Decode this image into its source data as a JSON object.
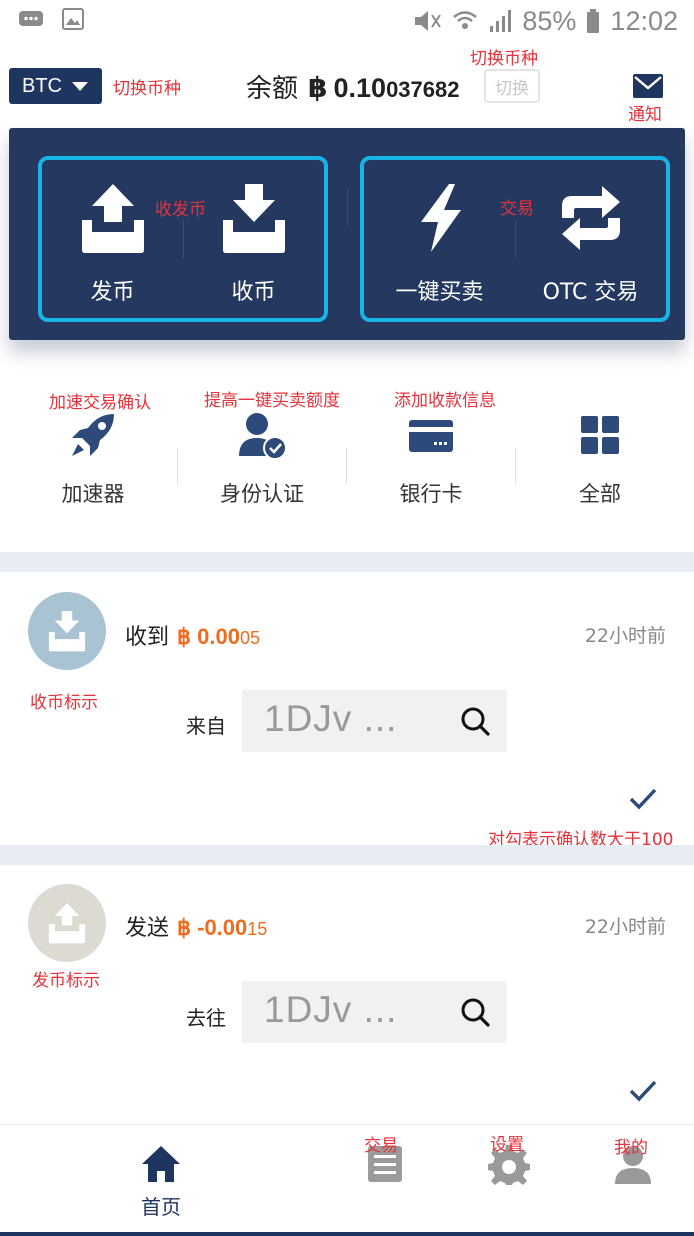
{
  "status_bar": {
    "battery": "85%",
    "time": "12:02"
  },
  "header": {
    "coin": "BTC",
    "balance_label": "余额",
    "btc_symbol": "฿",
    "balance_main": "0.10",
    "balance_rest": "037682",
    "switch_label": "切换"
  },
  "actions": {
    "send": "发币",
    "receive": "收币",
    "quick_trade": "一键买卖",
    "otc": "OTC 交易"
  },
  "quick_menu": [
    {
      "label": "加速器"
    },
    {
      "label": "身份认证"
    },
    {
      "label": "银行卡"
    },
    {
      "label": "全部"
    }
  ],
  "transactions": [
    {
      "type": "收到",
      "amount_main": "฿ 0.00",
      "amount_rest": "05",
      "time": "22小时前",
      "dir_label": "来自",
      "address": "1DJv ..."
    },
    {
      "type": "发送",
      "amount_main": "฿ -0.00",
      "amount_rest": "15",
      "time": "22小时前",
      "dir_label": "去往",
      "address": "1DJv ..."
    }
  ],
  "tabs": [
    {
      "label": "首页"
    }
  ],
  "annotations": {
    "switch_coin_left": "切换币种",
    "switch_coin_top": "切换币种",
    "notify": "通知",
    "send_receive": "收发币",
    "trade": "交易",
    "accelerate": "加速交易确认",
    "raise_limit": "提高一键买卖额度",
    "add_payment": "添加收款信息",
    "receive_mark": "收币标示",
    "check_meaning": "对勾表示确认数大于100",
    "send_mark": "发币标示",
    "tab_trade": "交易",
    "tab_settings": "设置",
    "tab_mine": "我的"
  },
  "colors": {
    "navy": "#1e3560",
    "panel": "#25385f",
    "frame": "#19b4e6",
    "orange": "#f06b1e",
    "annotation": "#e8313a"
  }
}
